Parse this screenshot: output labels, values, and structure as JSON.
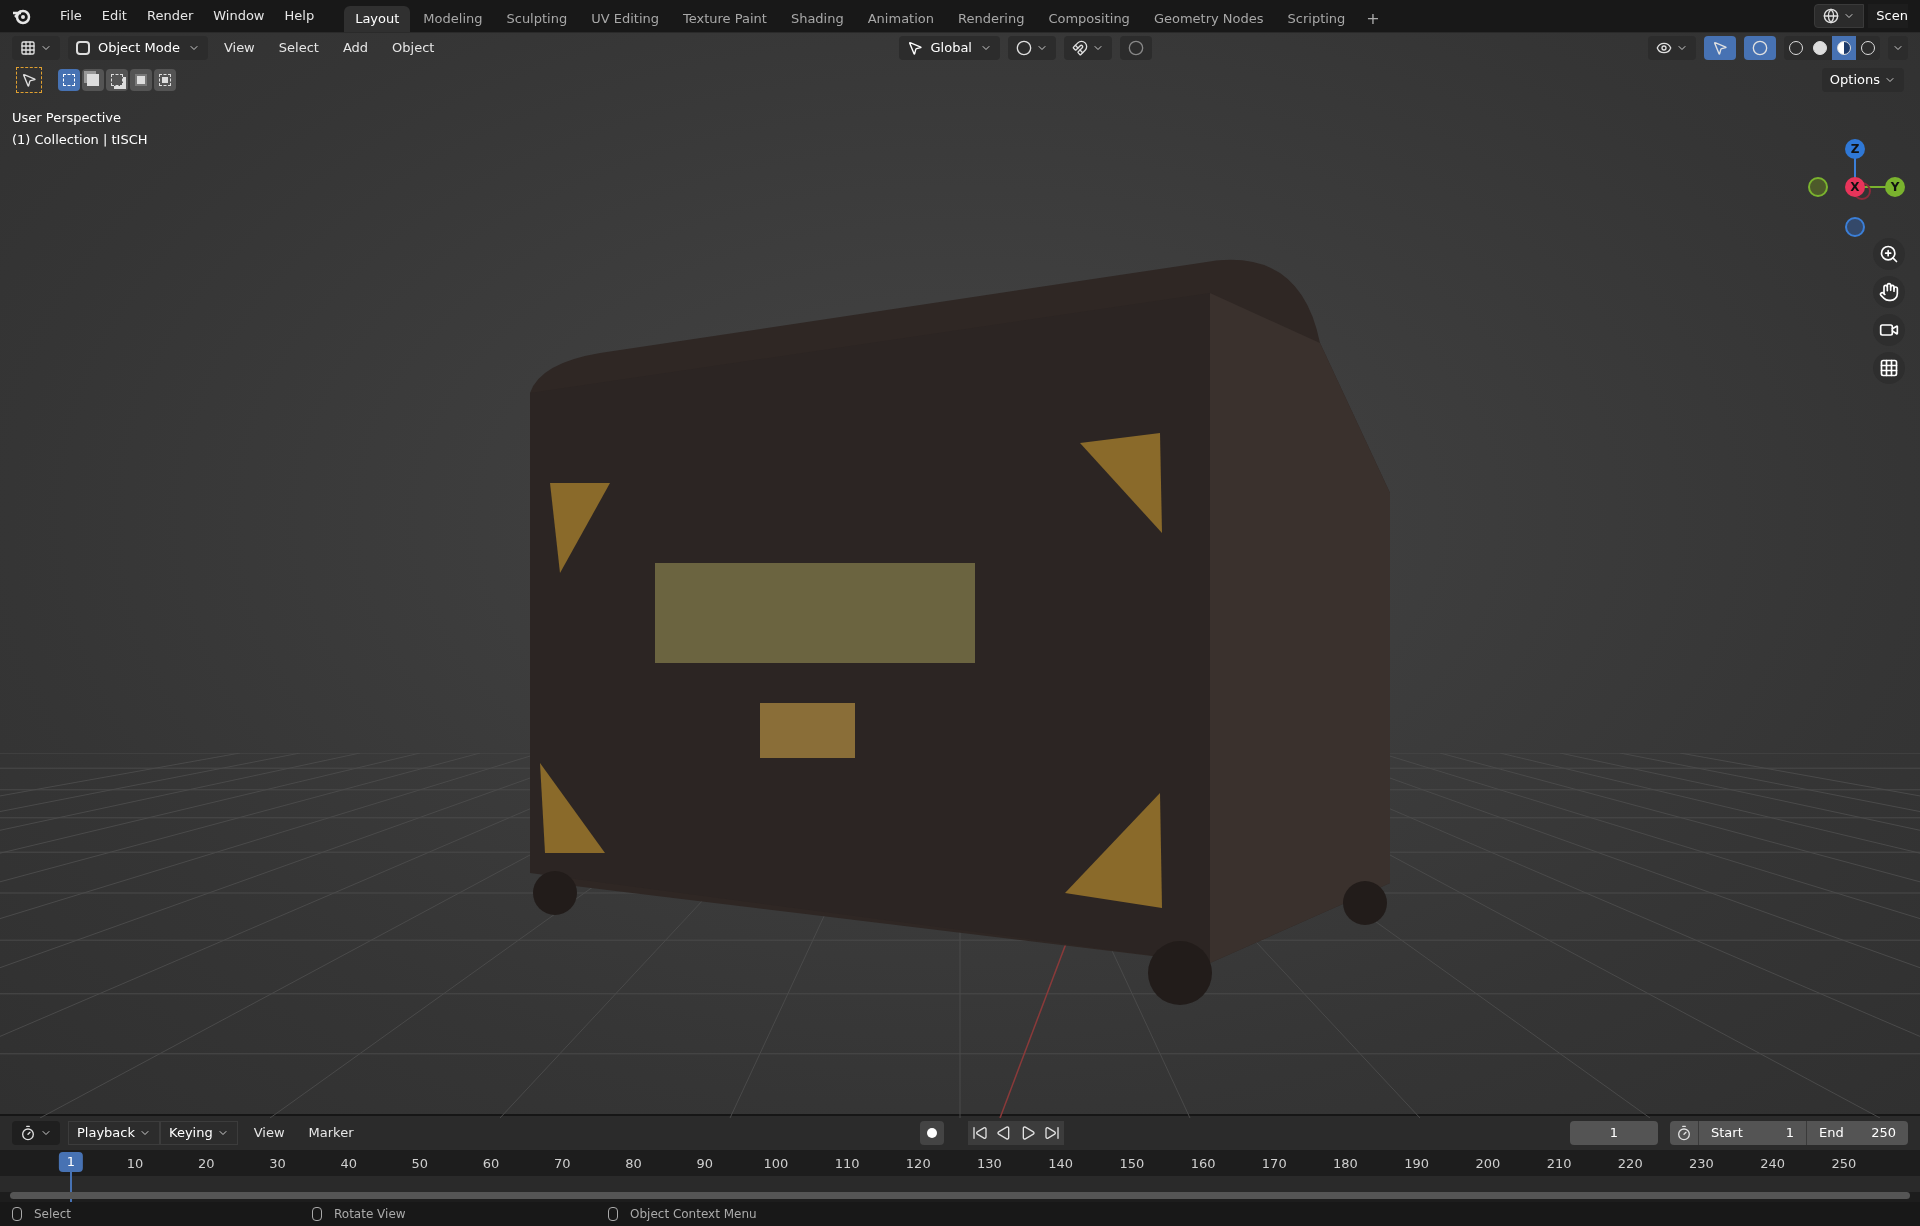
{
  "top_menu": [
    "File",
    "Edit",
    "Render",
    "Window",
    "Help"
  ],
  "workspaces": [
    {
      "label": "Layout",
      "selected": true
    },
    {
      "label": "Modeling",
      "selected": false
    },
    {
      "label": "Sculpting",
      "selected": false
    },
    {
      "label": "UV Editing",
      "selected": false
    },
    {
      "label": "Texture Paint",
      "selected": false
    },
    {
      "label": "Shading",
      "selected": false
    },
    {
      "label": "Animation",
      "selected": false
    },
    {
      "label": "Rendering",
      "selected": false
    },
    {
      "label": "Compositing",
      "selected": false
    },
    {
      "label": "Geometry Nodes",
      "selected": false
    },
    {
      "label": "Scripting",
      "selected": false
    }
  ],
  "add_workspace": "+",
  "scene": "Scen",
  "viewport_header": {
    "mode": "Object Mode",
    "menus": [
      "View",
      "Select",
      "Add",
      "Object"
    ],
    "orientation": "Global"
  },
  "select_modes": [
    {
      "kind": "new",
      "selected": true
    },
    {
      "kind": "extend",
      "selected": false
    },
    {
      "kind": "subtract",
      "selected": false
    },
    {
      "kind": "invert",
      "selected": false
    },
    {
      "kind": "intersect",
      "selected": false
    }
  ],
  "toggles": {
    "gizmos": true,
    "overlays": true
  },
  "shading_modes": [
    {
      "kind": "wireframe",
      "selected": false
    },
    {
      "kind": "solid",
      "selected": false
    },
    {
      "kind": "material",
      "selected": true
    },
    {
      "kind": "rendered",
      "selected": false
    }
  ],
  "options": "Options",
  "overlay_text": [
    "User Perspective",
    "(1) Collection | tISCH"
  ],
  "gizmo_axes": [
    "Z",
    "X",
    "Y"
  ],
  "timeline": {
    "menus": [
      "Playback",
      "Keying",
      "View",
      "Marker"
    ],
    "current_frame": "1",
    "start_label": "Start",
    "start": "1",
    "end_label": "End",
    "end": "250",
    "playhead": "1",
    "ticks": [
      "10",
      "20",
      "30",
      "40",
      "50",
      "60",
      "70",
      "80",
      "90",
      "100",
      "110",
      "120",
      "130",
      "140",
      "150",
      "160",
      "170",
      "180",
      "190",
      "200",
      "210",
      "220",
      "230",
      "240",
      "250"
    ]
  },
  "status_bar": [
    "Select",
    "Rotate View",
    "Object Context Menu"
  ]
}
